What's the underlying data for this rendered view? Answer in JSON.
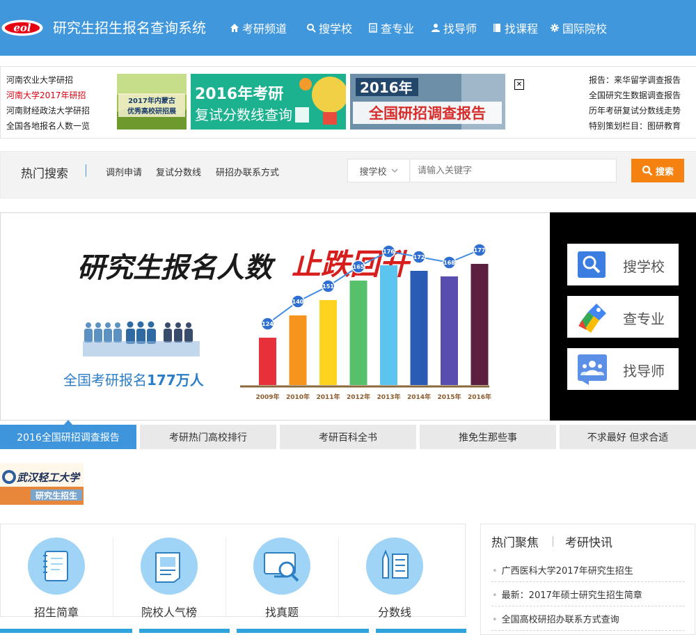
{
  "header": {
    "site_title": "研究生招生报名查询系统",
    "logo_text": "eol",
    "nav": [
      {
        "label": "考研频道",
        "icon": "home-icon"
      },
      {
        "label": "搜学校",
        "icon": "search-icon"
      },
      {
        "label": "查专业",
        "icon": "list-icon"
      },
      {
        "label": "找导师",
        "icon": "user-icon"
      },
      {
        "label": "找课程",
        "icon": "book-icon"
      },
      {
        "label": "国际院校",
        "icon": "gear-icon"
      }
    ],
    "colors": {
      "header": "#4097dc",
      "accent": "#f58210"
    }
  },
  "ads": {
    "left_links": [
      "河南农业大学研招",
      "河南大学2017年研招",
      "河南财经政法大学研招",
      "全国各地报名人数一览"
    ],
    "ad1": {
      "line1": "2017年内蒙古",
      "line2": "优秀高校研招展"
    },
    "ad2": {
      "line1": "2016年考研",
      "line2": "复试分数线查询"
    },
    "ad3": {
      "line1": "2016年",
      "line2": "全国研招调查报告"
    },
    "close_symbol": "✕",
    "right_links": [
      "报告：来华留学调查报告",
      "全国研究生数据调查报告",
      "历年考研复试分数线走势",
      "特别策划栏目：图研教育"
    ]
  },
  "search": {
    "hot_title": "热门搜索",
    "hot_links": [
      "调剂申请",
      "复试分数线",
      "研招办联系方式"
    ],
    "select_value": "搜学校",
    "placeholder": "请输入关键字",
    "button_label": "搜索"
  },
  "banner": {
    "headline_a": "研究生报名人数",
    "headline_b": "止跌回升",
    "caption_prefix": "全国考研报名",
    "caption_number": "177万人"
  },
  "chart_data": {
    "type": "bar",
    "categories": [
      "2009年",
      "2010年",
      "2011年",
      "2012年",
      "2013年",
      "2014年",
      "2015年",
      "2016年"
    ],
    "values": [
      124,
      140,
      151,
      165,
      176,
      172,
      168,
      177
    ],
    "colors": [
      "#e6303a",
      "#f7941d",
      "#fdd320",
      "#57c06a",
      "#5bc4ef",
      "#2a5bb5",
      "#5a4db0",
      "#5c1f3f"
    ],
    "line_color": "#3f8ce0",
    "title": "",
    "xlabel": "",
    "ylabel": ""
  },
  "quick_buttons": [
    {
      "label": "搜学校",
      "icon": "magnifier-icon"
    },
    {
      "label": "查专业",
      "icon": "tag-icon"
    },
    {
      "label": "找导师",
      "icon": "teacher-icon"
    }
  ],
  "tabs": [
    "2016全国研招调查报告",
    "考研热门高校排行",
    "考研百科全书",
    "推免生那些事",
    "不求最好 但求合适"
  ],
  "uni_logo": {
    "name": "武汉轻工大学",
    "sub": "研究生招生"
  },
  "services": [
    {
      "label": "招生简章",
      "icon": "notebook-icon"
    },
    {
      "label": "院校人气榜",
      "icon": "document-icon"
    },
    {
      "label": "找真题",
      "icon": "monitor-search-icon"
    },
    {
      "label": "分数线",
      "icon": "pencil-list-icon"
    }
  ],
  "news": {
    "tabs": [
      "热门聚焦",
      "考研快讯"
    ],
    "items": [
      "广西医科大学2017年研究生招生",
      "最新：2017年硕士研究生招生简章",
      "全国高校研招办联系方式查询"
    ]
  }
}
